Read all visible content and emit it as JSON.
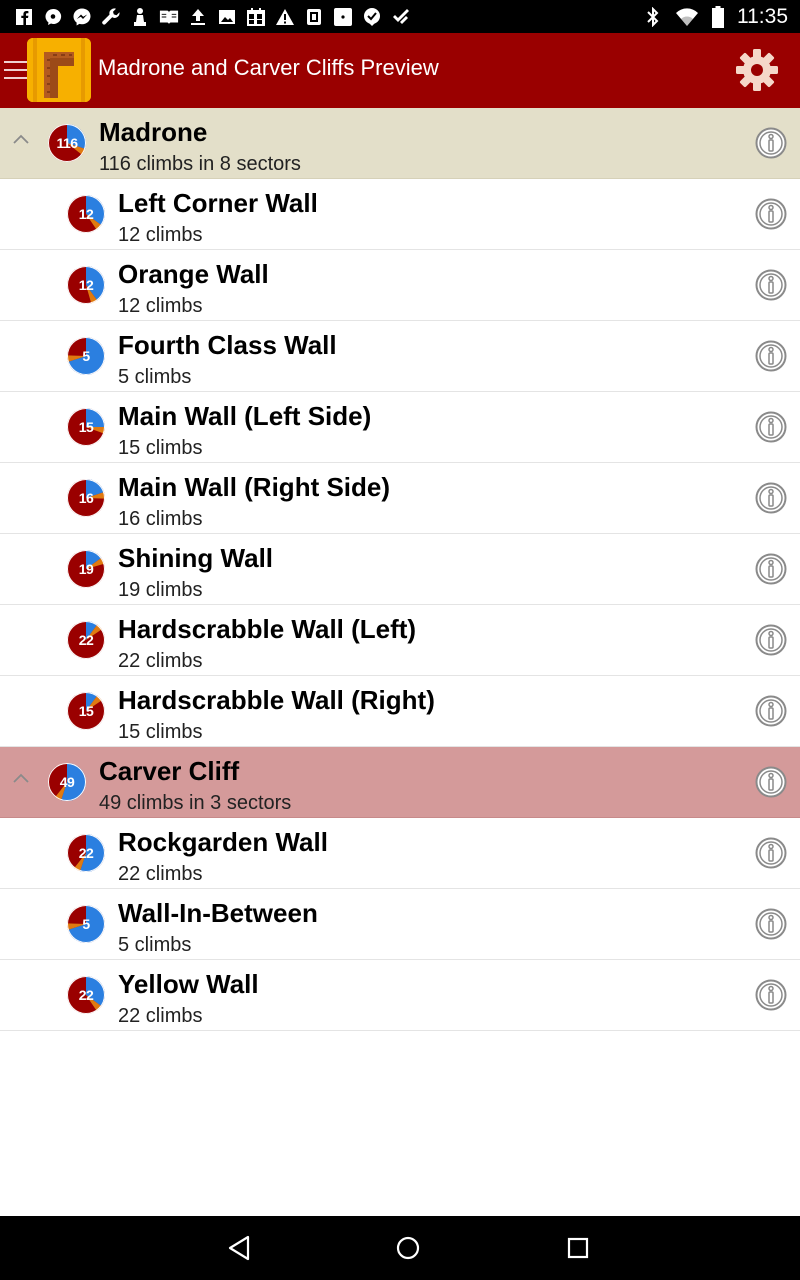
{
  "status": {
    "time": "11:35",
    "notification_icons": [
      "facebook-icon",
      "chat-bubble-icon",
      "messenger-icon",
      "wrench-icon",
      "chess-pawn-icon",
      "book-icon",
      "upload-icon",
      "image-icon",
      "calendar-icon",
      "warning-icon",
      "news-icon",
      "dot-box-icon",
      "location-check-icon",
      "feedly-icon"
    ],
    "system_icons": [
      "bluetooth-icon",
      "wifi-icon",
      "battery-icon"
    ]
  },
  "app_bar": {
    "title": "Madrone and Carver Cliffs Preview",
    "colors": {
      "bar": "#9a0000",
      "logo_bg": "#f7b000"
    }
  },
  "areas": [
    {
      "name": "Madrone",
      "count": "116",
      "subtitle": "116 climbs in 8 sectors",
      "bg": "#e3dfc9",
      "pie_blue_fraction": 0.3,
      "sectors": [
        {
          "name": "Left Corner Wall",
          "count": "12",
          "subtitle": "12 climbs",
          "pie_blue_fraction": 0.35
        },
        {
          "name": "Orange Wall",
          "count": "12",
          "subtitle": "12 climbs",
          "pie_blue_fraction": 0.4
        },
        {
          "name": "Fourth Class Wall",
          "count": "5",
          "subtitle": "5 climbs",
          "pie_blue_fraction": 0.7
        },
        {
          "name": "Main Wall (Left Side)",
          "count": "15",
          "subtitle": "15 climbs",
          "pie_blue_fraction": 0.25
        },
        {
          "name": "Main Wall (Right Side)",
          "count": "16",
          "subtitle": "16 climbs",
          "pie_blue_fraction": 0.2
        },
        {
          "name": "Shining Wall",
          "count": "19",
          "subtitle": "19 climbs",
          "pie_blue_fraction": 0.15
        },
        {
          "name": "Hardscrabble Wall (Left)",
          "count": "22",
          "subtitle": "22 climbs",
          "pie_blue_fraction": 0.1
        },
        {
          "name": "Hardscrabble Wall (Right)",
          "count": "15",
          "subtitle": "15 climbs",
          "pie_blue_fraction": 0.1
        }
      ]
    },
    {
      "name": "Carver Cliff",
      "count": "49",
      "subtitle": "49 climbs in 3 sectors",
      "bg": "#d49a9a",
      "pie_blue_fraction": 0.55,
      "sectors": [
        {
          "name": "Rockgarden Wall",
          "count": "22",
          "subtitle": "22 climbs",
          "pie_blue_fraction": 0.55
        },
        {
          "name": "Wall-In-Between",
          "count": "5",
          "subtitle": "5 climbs",
          "pie_blue_fraction": 0.7
        },
        {
          "name": "Yellow Wall",
          "count": "22",
          "subtitle": "22 climbs",
          "pie_blue_fraction": 0.35
        }
      ]
    }
  ],
  "colors": {
    "pie_red": "#9a0000",
    "pie_blue": "#2b7fe0",
    "pie_orange": "#e07a10"
  },
  "nav": {
    "buttons": [
      "back-button",
      "home-button",
      "recents-button"
    ]
  }
}
